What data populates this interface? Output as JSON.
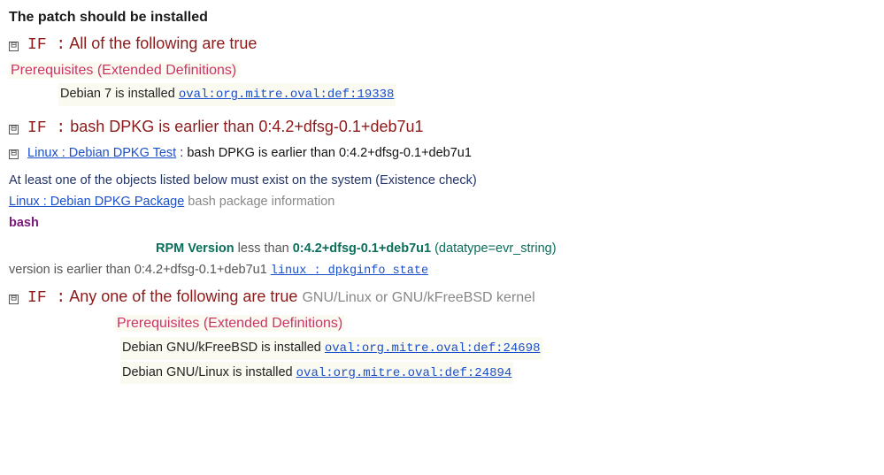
{
  "title": "The patch should be installed",
  "ui": {
    "expander_minus": "⊟"
  },
  "if1": {
    "ifword": "IF :",
    "text": " All of the following are true"
  },
  "prereq1": {
    "header": "Prerequisites (Extended Definitions)",
    "item_text": "Debian 7 is installed ",
    "item_oval": "oval:org.mitre.oval:def:19338"
  },
  "if2": {
    "ifword": "IF :",
    "text": " bash DPKG is earlier than 0:4.2+dfsg-0.1+deb7u1"
  },
  "test": {
    "link": "Linux : Debian DPKG Test",
    "colon": " :  ",
    "desc": "bash DPKG is earlier than 0:4.2+dfsg-0.1+deb7u1",
    "note": "At least one of the objects listed below must exist on the system (Existence check)",
    "obj_link": "Linux : Debian DPKG Package",
    "obj_desc": " bash package information",
    "pkg": "bash",
    "rpm_label": "RPM Version",
    "lt": " less than ",
    "evr": "0:4.2+dfsg-0.1+deb7u1",
    "datatype": " (datatype=evr_string)",
    "ver_earlier": "version is earlier than 0:4.2+dfsg-0.1+deb7u1 ",
    "state_link": "linux : dpkginfo_state"
  },
  "if3": {
    "ifword": "IF :",
    "text": " Any one of the following are true",
    "annot": " GNU/Linux or GNU/kFreeBSD kernel"
  },
  "prereq2": {
    "header": "Prerequisites (Extended Definitions)",
    "items": [
      {
        "text": "Debian GNU/kFreeBSD is installed ",
        "oval": "oval:org.mitre.oval:def:24698"
      },
      {
        "text": "Debian GNU/Linux is installed ",
        "oval": "oval:org.mitre.oval:def:24894"
      }
    ]
  }
}
